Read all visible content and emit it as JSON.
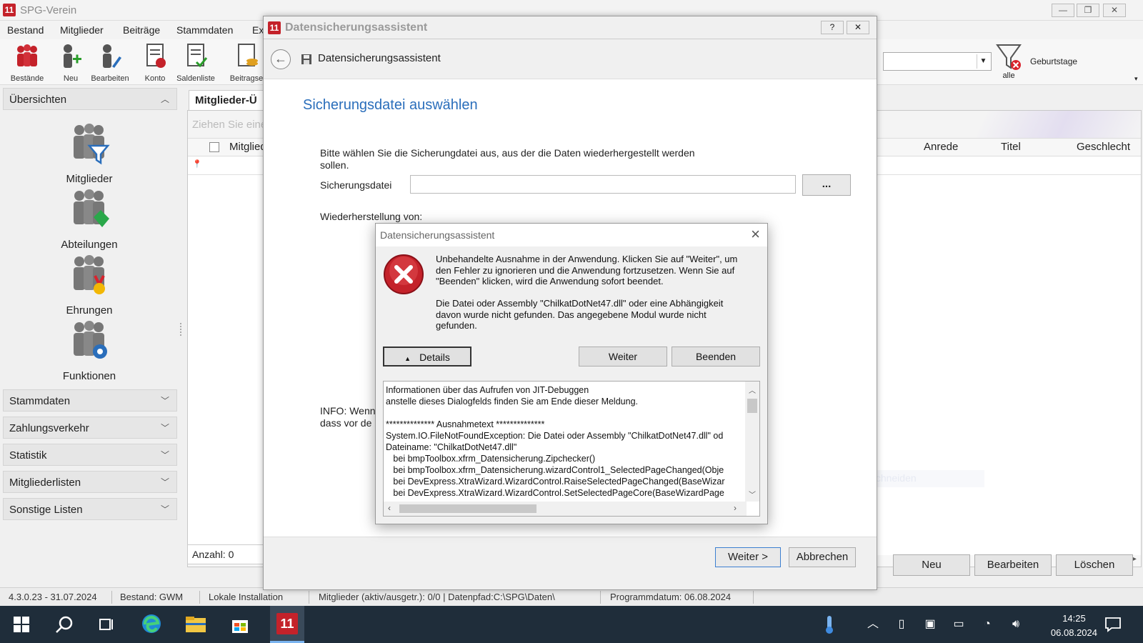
{
  "app": {
    "title": "SPG-Verein",
    "menu": [
      "Bestand",
      "Mitglieder",
      "Beiträge",
      "Stammdaten",
      "Ex"
    ],
    "ribbon": [
      "Bestände",
      "Neu",
      "Bearbeiten",
      "Konto",
      "Saldenliste",
      "Beitragse"
    ],
    "right_ribbon": {
      "filter_label": "alle",
      "birthdays": "Geburtstage"
    }
  },
  "sidebar": {
    "overview_header": "Übersichten",
    "nav_items": [
      "Mitglieder",
      "Abteilungen",
      "Ehrungen",
      "Funktionen"
    ],
    "sections": [
      "Stammdaten",
      "Zahlungsverkehr",
      "Statistik",
      "Mitgliederlisten",
      "Sonstige Listen"
    ]
  },
  "content": {
    "tab_title": "Mitglieder-Ü",
    "group_hint": "Ziehen Sie eine",
    "columns_left": [
      "Mitglied"
    ],
    "columns_right": [
      "Anrede",
      "Titel",
      "Geschlecht"
    ],
    "count_label": "Anzahl: 0",
    "buttons": [
      "Neu",
      "Bearbeiten",
      "Löschen"
    ],
    "ghost_text": "Vollbild ausschneiden"
  },
  "status": {
    "version": "4.3.0.23 - 31.07.2024",
    "bestand": "Bestand: GWM",
    "install": "Lokale Installation",
    "members": "Mitglieder (aktiv/ausgetr.): 0/0 | Datenpfad:C:\\SPG\\Daten\\",
    "progdate": "Programmdatum: 06.08.2024"
  },
  "wizard": {
    "window_title": "Datensicherungsassistent",
    "header_title": "Datensicherungsassistent",
    "page_title": "Sicherungsdatei auswählen",
    "instruction": "Bitte wählen Sie die Sicherungdatei aus, aus der die Daten wiederhergestellt werden sollen.",
    "file_label": "Sicherungsdatei",
    "file_value": "",
    "browse_label": "...",
    "restore_from": "Wiederherstellung von:",
    "info_line1": "INFO: Wenn",
    "info_line2": "dass vor de",
    "next_button": "Weiter >",
    "cancel_button": "Abbrechen"
  },
  "error_dialog": {
    "title": "Datensicherungsassistent",
    "message1": "Unbehandelte Ausnahme in der Anwendung. Klicken Sie auf \"Weiter\", um den Fehler zu ignorieren und die Anwendung fortzusetzen. Wenn Sie auf \"Beenden\" klicken, wird die Anwendung sofort beendet.",
    "message2": "Die Datei oder Assembly \"ChilkatDotNet47.dll\" oder eine Abhängigkeit davon wurde nicht gefunden. Das angegebene Modul wurde nicht gefunden.",
    "details_button": "Details",
    "continue_button": "Weiter",
    "quit_button": "Beenden",
    "details_text": "Informationen über das Aufrufen von JIT-Debuggen\nanstelle dieses Dialogfelds finden Sie am Ende dieser Meldung.\n\n************** Ausnahmetext **************\nSystem.IO.FileNotFoundException: Die Datei oder Assembly \"ChilkatDotNet47.dll\" od\nDateiname: \"ChilkatDotNet47.dll\"\n   bei bmpToolbox.xfrm_Datensicherung.Zipchecker()\n   bei bmpToolbox.xfrm_Datensicherung.wizardControl1_SelectedPageChanged(Obje\n   bei DevExpress.XtraWizard.WizardControl.RaiseSelectedPageChanged(BaseWizar\n   bei DevExpress.XtraWizard.WizardControl.SetSelectedPageCore(BaseWizardPage"
  },
  "taskbar": {
    "time": "14:25",
    "date": "06.08.2024"
  },
  "colors": {
    "accent_red": "#c4222a",
    "title_blue": "#2a6ebb",
    "taskbar": "#1f2d3a"
  }
}
